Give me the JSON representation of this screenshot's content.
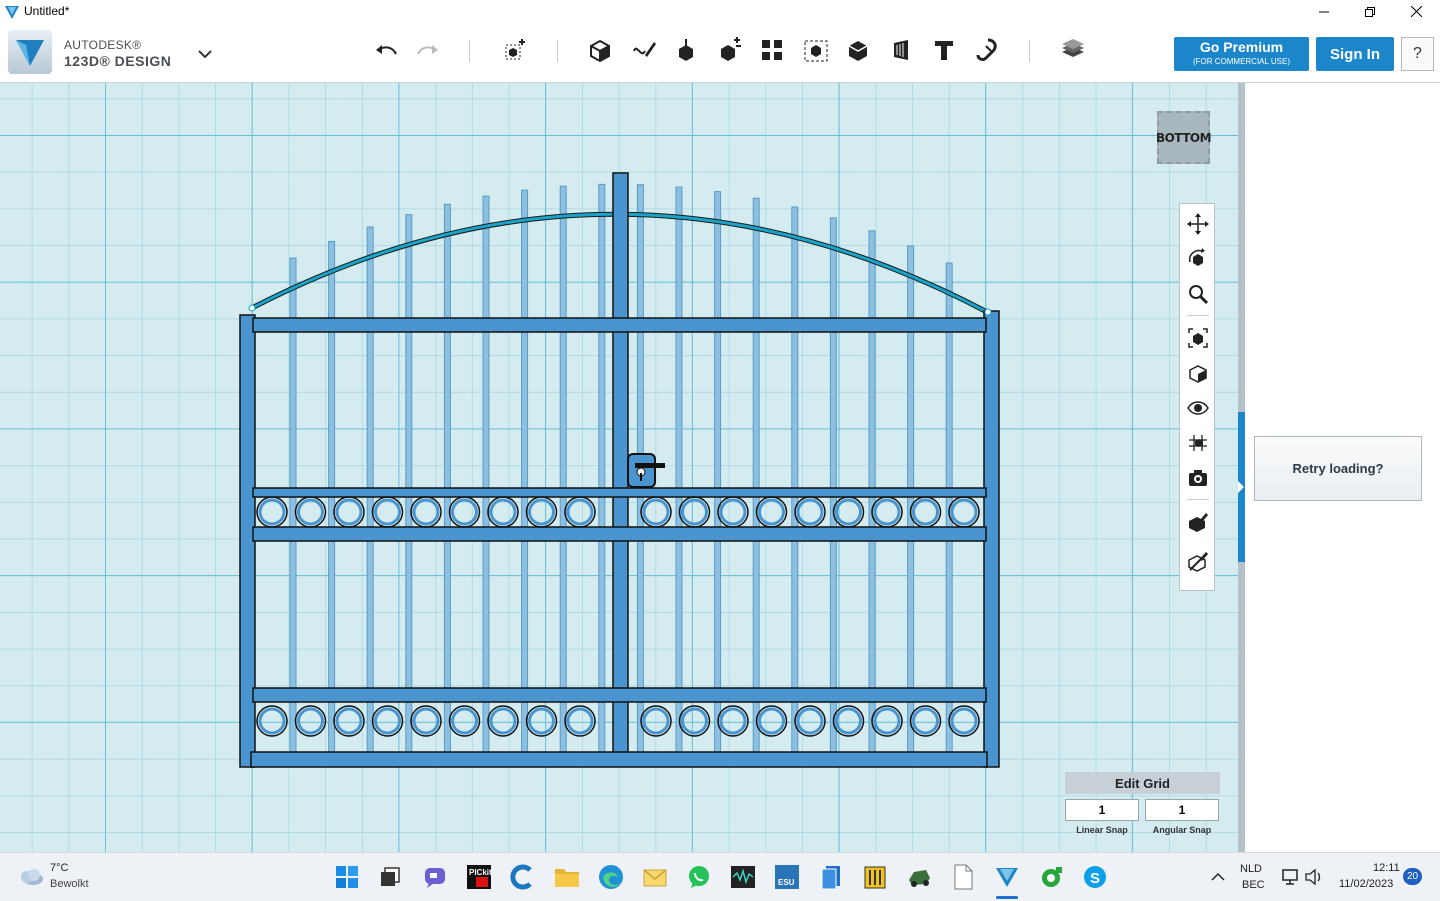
{
  "window": {
    "title": "Untitled*"
  },
  "brand": {
    "line1": "AUTODESK®",
    "line2": "123D® DESIGN"
  },
  "toolbar": {
    "tools": [
      "undo-icon",
      "redo-icon",
      "primitives-icon",
      "sketch-icon",
      "construct-icon",
      "modify-icon",
      "pattern-icon",
      "grouping-icon",
      "combine-icon",
      "measure-icon",
      "text-icon",
      "snap-icon",
      "materials-icon"
    ]
  },
  "account": {
    "premium_label": "Go Premium",
    "premium_sub": "(FOR COMMERCIAL USE)",
    "signin_label": "Sign In",
    "help_label": "?"
  },
  "viewcube": {
    "label": "BOTTOM"
  },
  "navbar": {
    "tools": [
      "pan-icon",
      "orbit-icon",
      "zoom-icon",
      "fit-icon",
      "views-icon",
      "visibility-icon",
      "grid-icon",
      "camera-icon",
      "material-icon",
      "outline-icon"
    ]
  },
  "side_panel": {
    "retry_label": "Retry loading?"
  },
  "grid_editor": {
    "title": "Edit Grid",
    "linear_value": "1",
    "linear_label": "Linear Snap",
    "angular_value": "1",
    "angular_label": "Angular Snap"
  },
  "taskbar": {
    "weather_temp": "7°C",
    "weather_desc": "Bewolkt",
    "language": "NLD",
    "keyboard": "BEC",
    "time": "12:11",
    "date": "11/02/2023",
    "notifications": "20"
  },
  "colors": {
    "accent": "#1b86c9",
    "model": "#4d9ad3",
    "grid_bg": "#d4ecf0"
  }
}
